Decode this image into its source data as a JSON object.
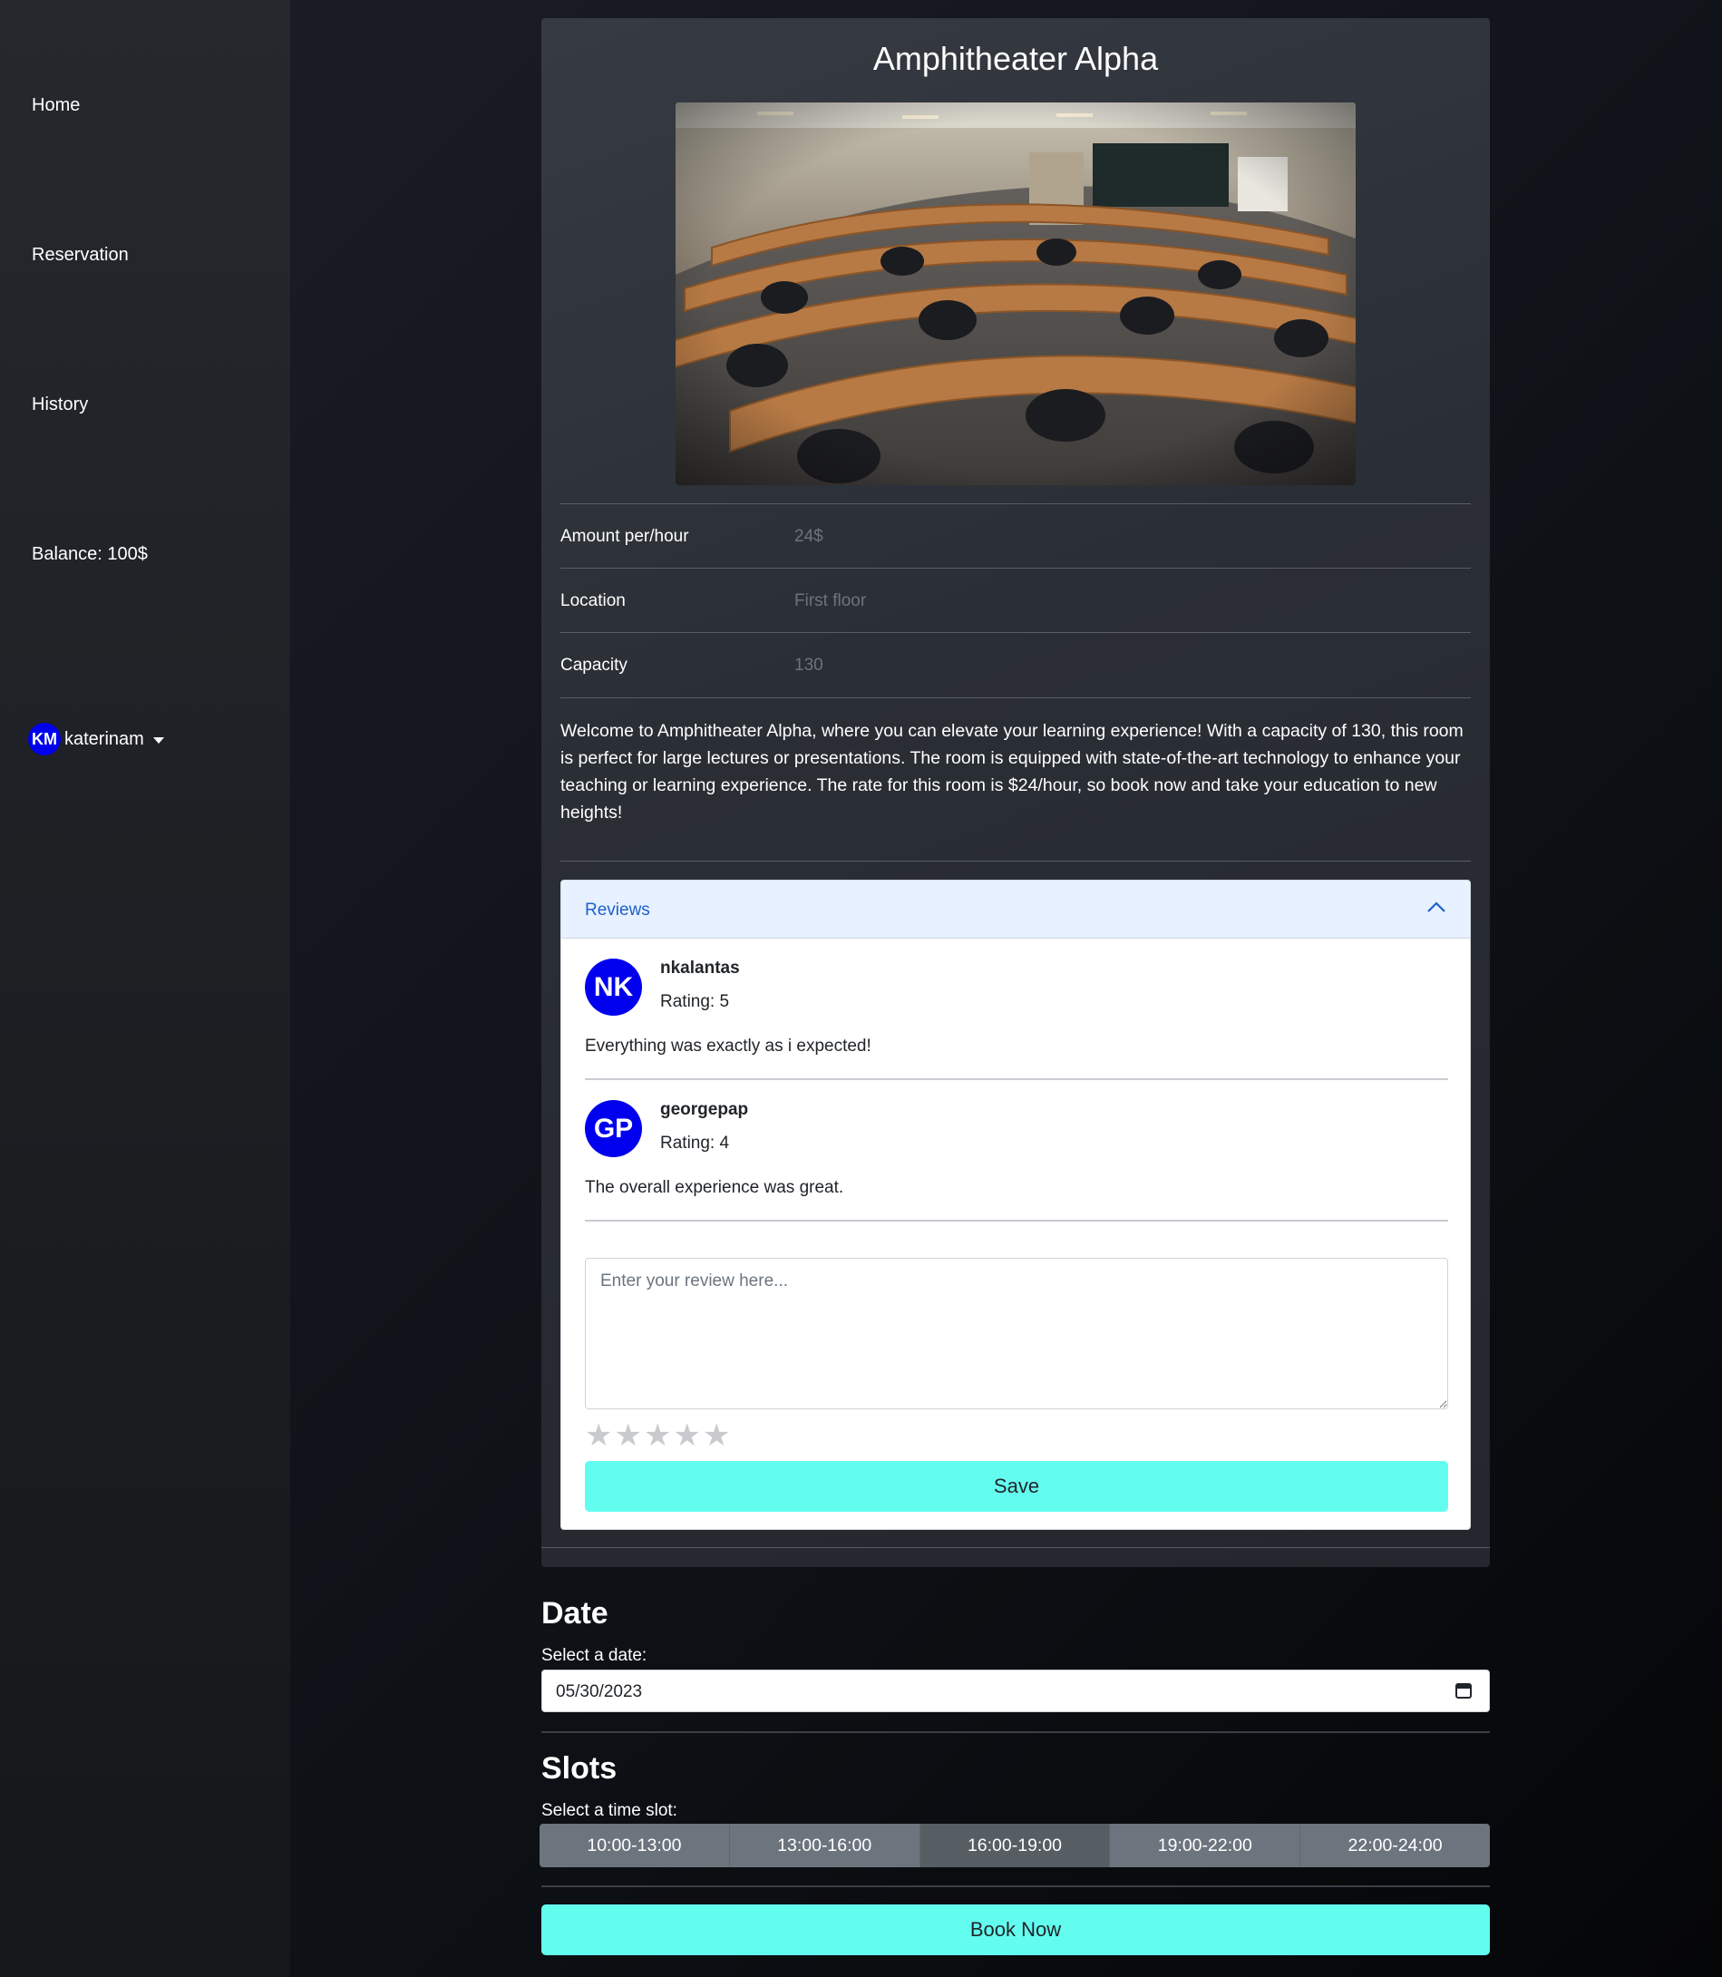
{
  "sidebar": {
    "items": [
      {
        "label": "Home"
      },
      {
        "label": "Reservation"
      },
      {
        "label": "History"
      },
      {
        "label": "Balance: 100$"
      }
    ],
    "user": {
      "initials": "KM",
      "name": "katerinam"
    }
  },
  "room": {
    "title": "Amphitheater Alpha",
    "details": [
      {
        "label": "Amount per/hour",
        "value": "24$"
      },
      {
        "label": "Location",
        "value": "First floor"
      },
      {
        "label": "Capacity",
        "value": "130"
      }
    ],
    "description": "Welcome to Amphitheater Alpha, where you can elevate your learning experience! With a capacity of 130, this room is perfect for large lectures or presentations. The room is equipped with state-of-the-art technology to enhance your teaching or learning experience. The rate for this room is $24/hour, so book now and take your education to new heights!"
  },
  "reviews": {
    "title": "Reviews",
    "items": [
      {
        "initials": "NK",
        "user": "nkalantas",
        "rating": "Rating: 5",
        "text": "Everything was exactly as i expected!"
      },
      {
        "initials": "GP",
        "user": "georgepap",
        "rating": "Rating: 4",
        "text": "The overall experience was great."
      }
    ],
    "placeholder": "Enter your review here...",
    "stars": "★",
    "save_label": "Save"
  },
  "date": {
    "title": "Date",
    "label": "Select a date:",
    "value": "05/30/2023"
  },
  "slots": {
    "title": "Slots",
    "label": "Select a time slot:",
    "items": [
      "10:00-13:00",
      "13:00-16:00",
      "16:00-19:00",
      "19:00-22:00",
      "22:00-24:00"
    ],
    "selected": "16:00-19:00"
  },
  "book_label": "Book Now",
  "colors": {
    "accent": "#63fdf0",
    "avatar": "#0000ee",
    "slot": "#6c757d",
    "slot_selected": "#565e64"
  }
}
